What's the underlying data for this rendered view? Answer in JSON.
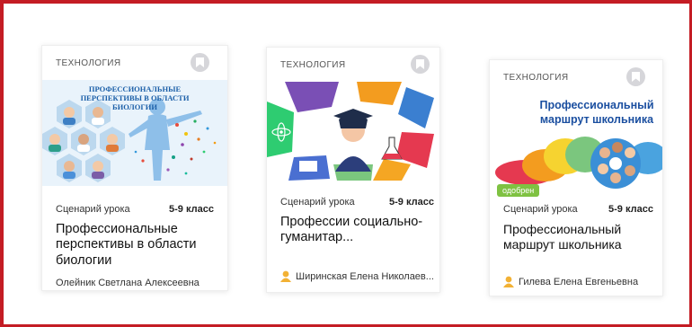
{
  "cards": [
    {
      "category": "ТЕХНОЛОГИЯ",
      "image_banner": "ПРОФЕССИОНАЛЬНЫЕ ПЕРСПЕКТИВЫ В ОБЛАСТИ БИОЛОГИИ",
      "lesson_type": "Сценарий урока",
      "grade": "5-9 класс",
      "title": "Профессиональные перспективы в области биологии",
      "author": "Олейник Светлана Алексеевна"
    },
    {
      "category": "ТЕХНОЛОГИЯ",
      "lesson_type": "Сценарий урока",
      "grade": "5-9 класс",
      "title": "Профессии социально-гуманитар...",
      "author": "Ширинская Елена Николаев..."
    },
    {
      "category": "ТЕХНОЛОГИЯ",
      "image_banner": "Профессиональный маршрут школьника",
      "badge": "одобрен",
      "lesson_type": "Сценарий урока",
      "grade": "5-9 класс",
      "title": "Профессиональный маршрут школьника",
      "author": "Гилева Елена Евгеньевна"
    }
  ],
  "icons": {
    "bookmark": "bookmark-icon",
    "author": "person-icon"
  },
  "colors": {
    "frame": "#c41c24",
    "badge": "#7fc242",
    "author_icon": "#f2b134"
  }
}
